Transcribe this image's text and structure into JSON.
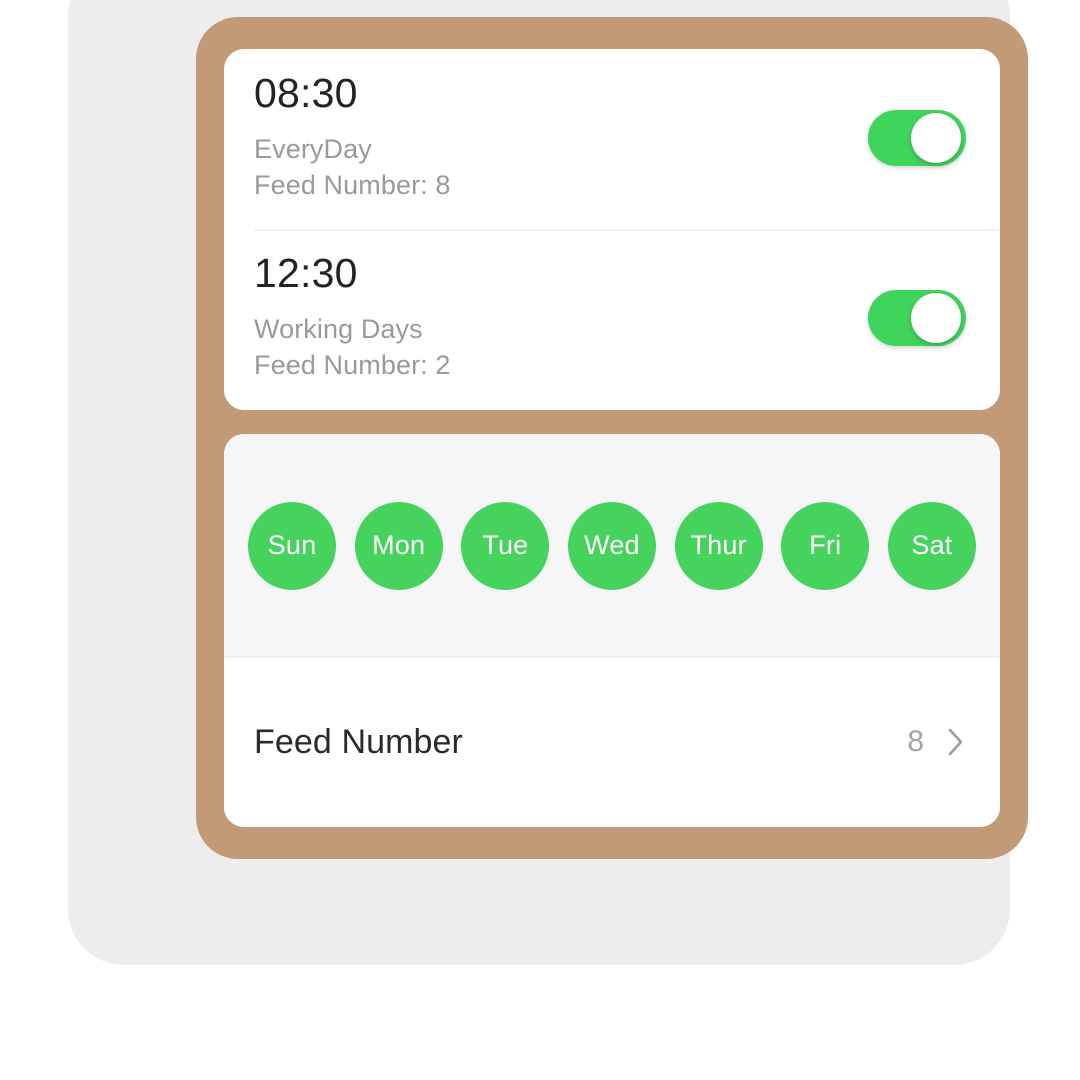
{
  "theme": {
    "frame_color": "#C29A78",
    "panel_bg": "#EDEDED",
    "card_bg": "#FFFFFF",
    "days_bg": "#F6F6F6",
    "accent_green": "#45D35D",
    "toggle_on_color": "#3FD45B",
    "primary_text": "#232323",
    "secondary_text": "#9A9A9A"
  },
  "alarms": [
    {
      "time": "08:30",
      "repeat": "EveryDay",
      "feed": "Feed Number: 8",
      "enabled": true,
      "toggle_state": "on"
    },
    {
      "time": "12:30",
      "repeat": "Working Days",
      "feed": "Feed Number: 2",
      "enabled": true,
      "toggle_state": "on"
    }
  ],
  "schedule": {
    "days": [
      {
        "label": "Sun",
        "selected": true
      },
      {
        "label": "Mon",
        "selected": true
      },
      {
        "label": "Tue",
        "selected": true
      },
      {
        "label": "Wed",
        "selected": true
      },
      {
        "label": "Thur",
        "selected": true
      },
      {
        "label": "Fri",
        "selected": true
      },
      {
        "label": "Sat",
        "selected": true
      }
    ],
    "feed_number": {
      "label": "Feed Number",
      "value": "8",
      "chevron": "chevron-right-icon"
    }
  }
}
